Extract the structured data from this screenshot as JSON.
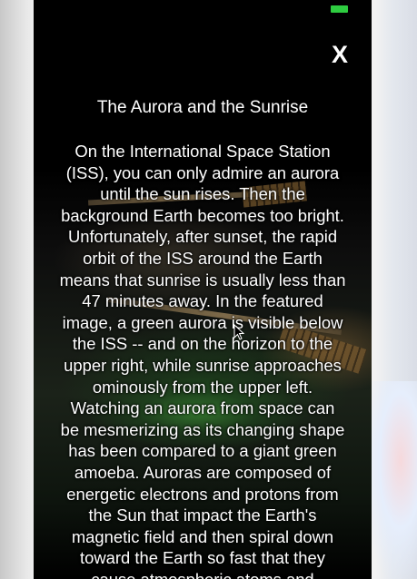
{
  "colors": {
    "background": "#000000",
    "text": "#ffffff",
    "indicator": "#2ecc40"
  },
  "header": {
    "close_label": "X"
  },
  "article": {
    "title": "The Aurora and the Sunrise",
    "lines": [
      "On the International Space Station",
      "(ISS), you can only admire an aurora",
      "until the sun rises. Then the",
      "background Earth becomes too bright.",
      "Unfortunately, after sunset, the rapid",
      "orbit of the ISS around the Earth",
      "means that sunrise is usually less than",
      "47 minutes away.  In the featured",
      "image, a green aurora is visible below",
      "the ISS -- and on the horizon to the",
      "upper right, while sunrise approaches",
      "ominously from the upper left.",
      "Watching an aurora from space can",
      "be mesmerizing as its changing shape",
      "has been compared to a giant green",
      "amoeba.  Auroras are composed of",
      "energetic electrons and protons from",
      "the Sun that impact the Earth's",
      "magnetic field and then spiral down",
      "toward the Earth so fast that they",
      "cause atmospheric atoms and"
    ]
  },
  "icons": {
    "close": "close-icon",
    "cursor": "mouse-pointer-icon"
  }
}
